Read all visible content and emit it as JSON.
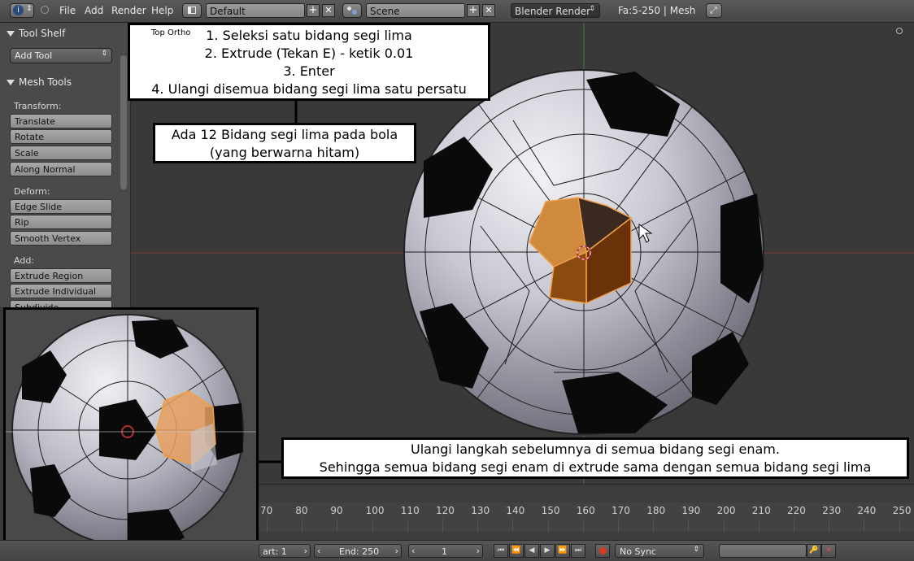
{
  "topbar": {
    "menus": [
      "File",
      "Add",
      "Render",
      "Help"
    ],
    "layout_value": "Default",
    "scene_value": "Scene",
    "engine_value": "Blender Render",
    "stats": "Fa:5-250 | Mesh"
  },
  "toolshelf": {
    "title": "Tool Shelf",
    "add_tool": "Add Tool",
    "mesh_tools": "Mesh Tools",
    "transform_label": "Transform:",
    "transform_buttons": [
      "Translate",
      "Rotate",
      "Scale",
      "Along Normal"
    ],
    "deform_label": "Deform:",
    "deform_buttons": [
      "Edge Slide",
      "Rip",
      "Smooth Vertex"
    ],
    "add_label": "Add:",
    "add_buttons": [
      "Extrude Region",
      "Extrude Individual",
      "Subdivide"
    ]
  },
  "viewport": {
    "view_label": "Top Ortho"
  },
  "notes": {
    "steps": [
      "1. Seleksi satu bidang segi lima",
      "2. Extrude (Tekan E) - ketik 0.01",
      "3. Enter",
      "4. Ulangi disemua bidang segi lima satu persatu"
    ],
    "pentagon_note": [
      "Ada 12 Bidang segi lima pada bola",
      "(yang berwarna hitam)"
    ],
    "hexagon_note": [
      "Ulangi langkah sebelumnya di semua bidang segi enam.",
      "Sehingga semua bidang segi enam di extrude sama dengan semua bidang segi lima"
    ]
  },
  "timeline": {
    "ticks": [
      "70",
      "80",
      "90",
      "100",
      "110",
      "120",
      "130",
      "140",
      "150",
      "160",
      "170",
      "180",
      "190",
      "200",
      "210",
      "220",
      "230",
      "240",
      "250"
    ],
    "start": "art: 1",
    "end": "End: 250",
    "current": "1",
    "sync": "No Sync"
  },
  "colors": {
    "selection": "#e8862b",
    "background": "#393939"
  }
}
